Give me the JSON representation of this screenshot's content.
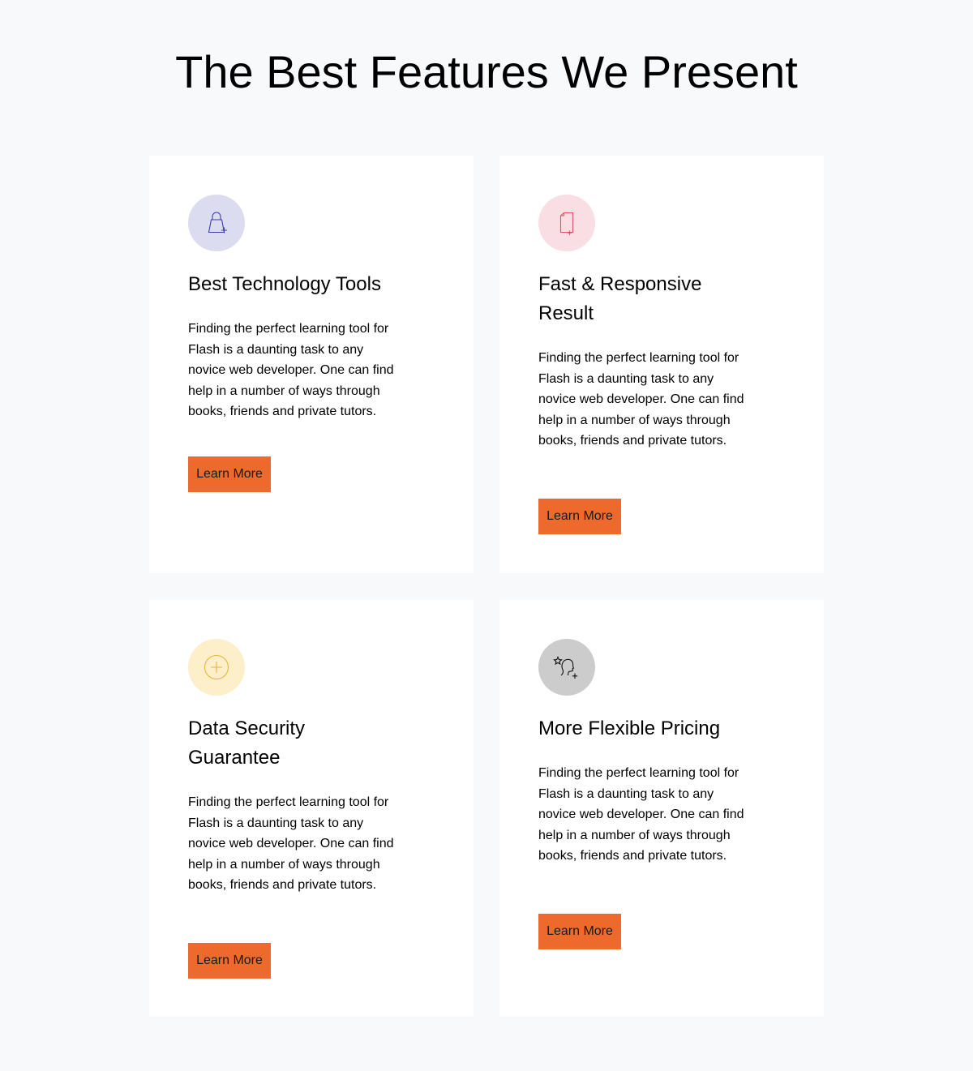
{
  "page": {
    "title": "The Best Features We Present"
  },
  "cards": [
    {
      "icon": "shopping-bag-plus-icon",
      "icon_bg": "#dcdcf0",
      "icon_color": "#3b3fa8",
      "title": "Best Technology Tools",
      "text": "Finding the perfect learning tool for Flash is a daunting task to any novice web developer. One can find help in a number of ways through books, friends and private tutors.",
      "button_label": "Learn More"
    },
    {
      "icon": "document-plus-icon",
      "icon_bg": "#f9dee3",
      "icon_color": "#e0526b",
      "title": "Fast & Responsive Result",
      "text": "Finding the perfect learning tool for Flash is a daunting task to any novice web developer. One can find help in a number of ways through books, friends and private tutors.",
      "button_label": "Learn More"
    },
    {
      "icon": "plus-circle-icon",
      "icon_bg": "#fdefc9",
      "icon_color": "#e8b53a",
      "title": "Data Security Guarantee",
      "text": "Finding the perfect learning tool for Flash is a daunting task to any novice web developer. One can find help in a number of ways through books, friends and private tutors.",
      "button_label": "Learn More"
    },
    {
      "icon": "user-star-icon",
      "icon_bg": "#cccccc",
      "icon_color": "#111111",
      "title": "More Flexible Pricing",
      "text": "Finding the perfect learning tool for Flash is a daunting task to any novice web developer. One can find help in a number of ways through books, friends and private tutors.",
      "button_label": "Learn More"
    }
  ],
  "colors": {
    "page_background": "#f8f9fb",
    "card_background": "#ffffff",
    "button_background": "#ee6a2c"
  }
}
